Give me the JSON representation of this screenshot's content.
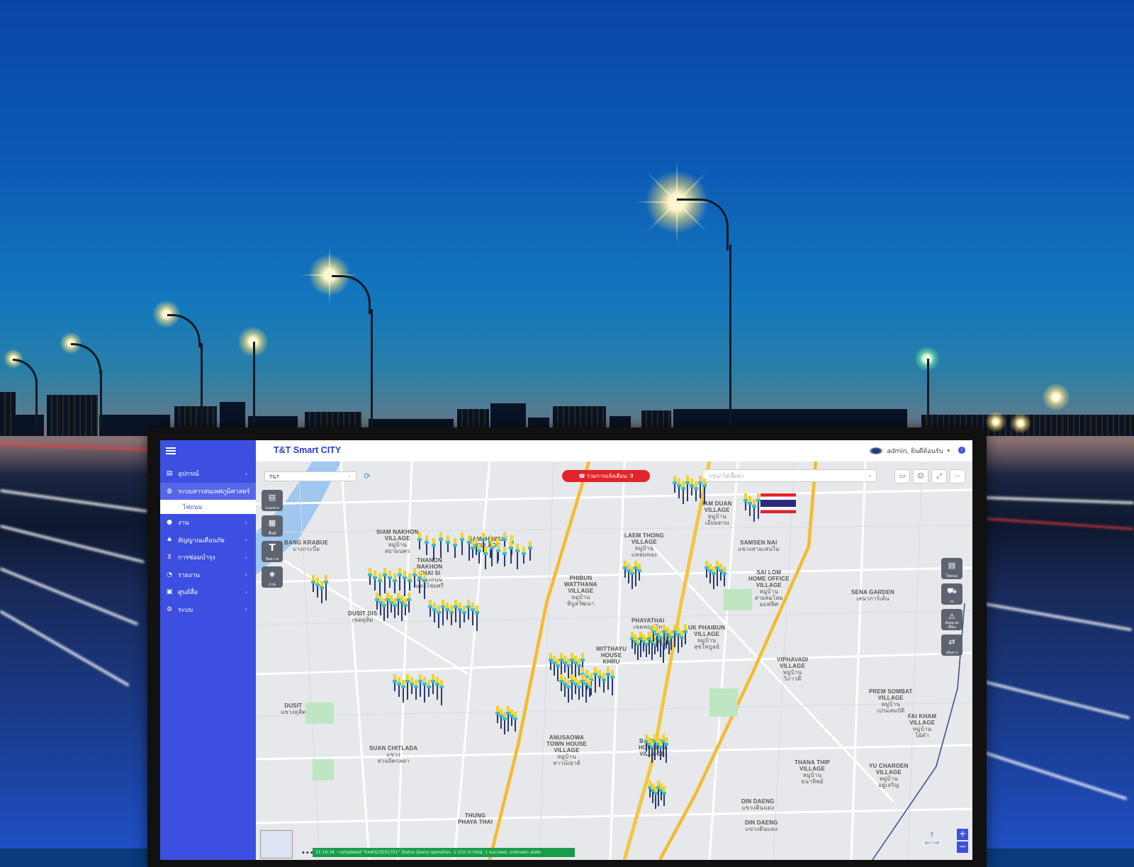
{
  "app": {
    "title": "T&T Smart CITY",
    "user": "admin, ยินดีต้อนรับ",
    "info_icon": "info-icon"
  },
  "sidebar": {
    "items": [
      {
        "label": "อุปกรณ์",
        "icon": "device-icon"
      },
      {
        "label": "ระบบสารสนเทศภูมิศาสตร์",
        "icon": "globe-icon",
        "active": true
      },
      {
        "label": "งาน",
        "icon": "pin-icon"
      },
      {
        "label": "สัญญาณเตือนภัย",
        "icon": "bell-icon"
      },
      {
        "label": "การซ่อมบำรุง",
        "icon": "cart-icon"
      },
      {
        "label": "รายงาน",
        "icon": "pie-icon"
      },
      {
        "label": "ศูนย์สื่อ",
        "icon": "media-icon"
      },
      {
        "label": "ระบบ",
        "icon": "gears-icon"
      }
    ],
    "sub_item": "ไฟถนน"
  },
  "map": {
    "select_value": "T&T",
    "alert_label": "รวมการแจ้งเตือน: 9",
    "search_placeholder": "กรุณาใส่เนื้อหา",
    "status_text": "21:16:34 - completed \"04#023501701\" Status Query operation. 1 LCU in total, 1 succeed, unknown state",
    "left_tools": [
      "ระยะทาง",
      "พื้นที่",
      "ข้อความ",
      "ภาพ"
    ],
    "right_tools": [
      "ไฟถนน",
      "รถ",
      "สัญญาณเตือน",
      "เส้นทาง"
    ],
    "labels": [
      {
        "text": "BANG KRABUE",
        "sub": "บางกระบือ"
      },
      {
        "text": "SIAM NAKHON\nVILLAGE",
        "sub": "หมู่บ้าน\nสยามนคร"
      },
      {
        "text": "SAMPHAWUT\nVILLAGE",
        "sub": ""
      },
      {
        "text": "THANON\nNAKHON\nCHAI SI",
        "sub": "แขวงถนน\nนครไชยศรี"
      },
      {
        "text": "DUSIT DIS",
        "sub": "เขตดุสิต"
      },
      {
        "text": "PHIBUN\nWATTHANA\nVILLAGE",
        "sub": "หมู่บ้าน\nพิบูลวัฒนา"
      },
      {
        "text": "LAEM THONG\nVILLAGE",
        "sub": "หมู่บ้าน\nแหลมทอง"
      },
      {
        "text": "IAM DUAN\nVILLAGE",
        "sub": "หมู่บ้าน\nเอี่ยมดวน"
      },
      {
        "text": "SAMSEN NAI",
        "sub": "แขวงสามเสนใน"
      },
      {
        "text": "SAI LOM\nHOME OFFICE\nVILLAGE",
        "sub": "หมู่บ้าน\nสายลมโฮม\nออฟฟิศ"
      },
      {
        "text": "SENA GARDEN",
        "sub": "เสนาการ์เด้น"
      },
      {
        "text": "PHAYATHAI",
        "sub": "เขตพญาไท"
      },
      {
        "text": "UK PHAIBUN\nVILLAGE",
        "sub": "หมู่บ้าน\nสุขไพบูลย์"
      },
      {
        "text": "VIPHAVADI\nVILLAGE",
        "sub": "หมู่บ้าน\nวิภาวดี"
      },
      {
        "text": "PREM SOMBAT\nVILLAGE",
        "sub": "หมู่บ้าน\nเปรมสมบัติ"
      },
      {
        "text": "FAI KHAM\nVILLAGE",
        "sub": "หมู่บ้าน\nไฝ่คำ"
      },
      {
        "text": "ANUSAOWA\nTOWN HOUSE\nVILLAGE",
        "sub": "หมู่บ้าน\nทาวน์เฮาส์"
      },
      {
        "text": "BANGKO\nHOUSING\nVILLAGE",
        "sub": ""
      },
      {
        "text": "THANA THIP\nVILLAGE",
        "sub": "หมู่บ้าน\nธนาทิพย์"
      },
      {
        "text": "YU CHAROEN\nVILLAGE",
        "sub": "หมู่บ้าน\nอยู่เจริญ"
      },
      {
        "text": "THUNG\nPHAYA THAI",
        "sub": ""
      },
      {
        "text": "DIN DAENG",
        "sub": "แขวงดินแดง"
      },
      {
        "text": "DIN DAENG",
        "sub": "แขวงดินแดง"
      },
      {
        "text": "SUAN CHITLADA",
        "sub": "แขวง\nสวนจิตรลดา"
      },
      {
        "text": "DUSIT",
        "sub": "แขวงดุสิต"
      },
      {
        "text": "WITTHAYU\nHOUSE\nKHRU",
        "sub": ""
      }
    ],
    "colors": {
      "sidebar": "#3d4fe0",
      "alert": "#e2232b",
      "status": "#1a9d4a",
      "expressway": "#f5c542"
    }
  }
}
